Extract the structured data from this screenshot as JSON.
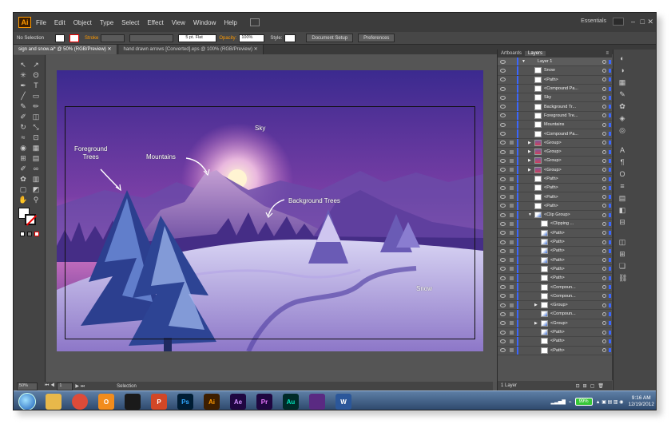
{
  "app": {
    "logo": "Ai",
    "menus": [
      "File",
      "Edit",
      "Object",
      "Type",
      "Select",
      "Effect",
      "View",
      "Window",
      "Help"
    ],
    "workspace": "Essentials"
  },
  "control": {
    "selection": "No Selection",
    "stroke_label": "Stroke",
    "brush": "5 pt. Flat",
    "opacity_label": "Opacity:",
    "opacity": "100%",
    "style_label": "Style:",
    "doc_setup": "Document Setup",
    "preferences": "Preferences"
  },
  "tabs": [
    "sign and snow.ai* @ 50% (RGB/Preview)",
    "hand drawn arrows [Converted].eps @ 100% (RGB/Preview)"
  ],
  "art_labels": {
    "sky": "Sky",
    "foreground": "Foreground\nTrees",
    "mountains": "Mountains",
    "background": "Background Trees",
    "snow": "Snow"
  },
  "status": {
    "zoom": "50%",
    "page": "1",
    "tool": "Selection"
  },
  "layers": {
    "tabs": [
      "Artboards",
      "Layers"
    ],
    "rows": [
      {
        "name": "Layer 1",
        "indent": 0,
        "expand": "open",
        "thumb": "none",
        "layer": true
      },
      {
        "name": "Snow",
        "indent": 1
      },
      {
        "name": "<Path>",
        "indent": 1
      },
      {
        "name": "<Compound Pa...",
        "indent": 1
      },
      {
        "name": "Sky",
        "indent": 1
      },
      {
        "name": "Background Tr...",
        "indent": 1
      },
      {
        "name": "Foreground Tre...",
        "indent": 1
      },
      {
        "name": "Mountains",
        "indent": 1
      },
      {
        "name": "<Compound Pa...",
        "indent": 1
      },
      {
        "name": "<Group>",
        "indent": 1,
        "expand": "closed",
        "thumb": "tree",
        "lock": true
      },
      {
        "name": "<Group>",
        "indent": 1,
        "expand": "closed",
        "thumb": "tree",
        "lock": true
      },
      {
        "name": "<Group>",
        "indent": 1,
        "expand": "closed",
        "thumb": "tree",
        "lock": true
      },
      {
        "name": "<Group>",
        "indent": 1,
        "expand": "closed",
        "thumb": "tree",
        "lock": true
      },
      {
        "name": "<Path>",
        "indent": 1,
        "lock": true
      },
      {
        "name": "<Path>",
        "indent": 1,
        "lock": true
      },
      {
        "name": "<Path>",
        "indent": 1,
        "lock": true
      },
      {
        "name": "<Path>",
        "indent": 1,
        "lock": true
      },
      {
        "name": "<Clip Group>",
        "indent": 1,
        "expand": "open",
        "thumb": "blue",
        "lock": true
      },
      {
        "name": "<Clipping ...",
        "indent": 2,
        "lock": true
      },
      {
        "name": "<Path>",
        "indent": 2,
        "thumb": "blue",
        "lock": true
      },
      {
        "name": "<Path>",
        "indent": 2,
        "thumb": "blue",
        "lock": true
      },
      {
        "name": "<Path>",
        "indent": 2,
        "thumb": "blue",
        "lock": true
      },
      {
        "name": "<Path>",
        "indent": 2,
        "thumb": "blue",
        "lock": true
      },
      {
        "name": "<Path>",
        "indent": 2,
        "lock": true
      },
      {
        "name": "<Path>",
        "indent": 2,
        "lock": true
      },
      {
        "name": "<Compoun...",
        "indent": 2,
        "lock": true
      },
      {
        "name": "<Compoun...",
        "indent": 2,
        "lock": true
      },
      {
        "name": "<Group>",
        "indent": 2,
        "expand": "closed",
        "lock": true
      },
      {
        "name": "<Compoun...",
        "indent": 2,
        "thumb": "blue",
        "lock": true
      },
      {
        "name": "<Group>",
        "indent": 2,
        "expand": "closed",
        "thumb": "blue",
        "lock": true
      },
      {
        "name": "<Path>",
        "indent": 2,
        "thumb": "blue",
        "lock": true
      },
      {
        "name": "<Path>",
        "indent": 2,
        "lock": true
      },
      {
        "name": "<Path>",
        "indent": 2,
        "lock": true
      }
    ],
    "footer": "1 Layer"
  },
  "taskbar": {
    "apps": [
      {
        "name": "explorer",
        "label": "",
        "color": "#e8b84a",
        "fg": "#fff"
      },
      {
        "name": "chrome",
        "label": "",
        "color": "#dd4b39",
        "fg": "#fff"
      },
      {
        "name": "outlook",
        "label": "O",
        "color": "#f28c1c",
        "fg": "#fff"
      },
      {
        "name": "spotify",
        "label": "",
        "color": "#1a1a1a",
        "fg": "#84bd00"
      },
      {
        "name": "powerpoint",
        "label": "P",
        "color": "#d24726",
        "fg": "#fff"
      },
      {
        "name": "photoshop",
        "label": "Ps",
        "color": "#001d34",
        "fg": "#31a8ff"
      },
      {
        "name": "illustrator",
        "label": "Ai",
        "color": "#3d1e00",
        "fg": "#ff9a00"
      },
      {
        "name": "after-effects",
        "label": "Ae",
        "color": "#1f0740",
        "fg": "#d291ff"
      },
      {
        "name": "premiere",
        "label": "Pr",
        "color": "#1f0740",
        "fg": "#ea77ff"
      },
      {
        "name": "audition",
        "label": "Au",
        "color": "#002b28",
        "fg": "#00e4bb"
      },
      {
        "name": "app-purple",
        "label": "",
        "color": "#5a2a82",
        "fg": "#fff"
      },
      {
        "name": "word",
        "label": "W",
        "color": "#2b579a",
        "fg": "#fff"
      }
    ],
    "battery": "99%",
    "time": "9:16 AM",
    "date": "12/19/2012"
  }
}
